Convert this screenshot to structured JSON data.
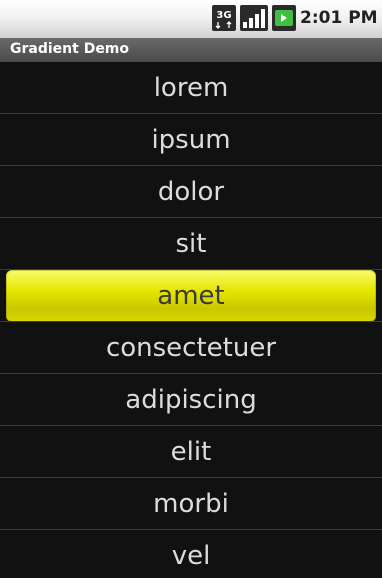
{
  "status_bar": {
    "time": "2:01 PM",
    "network_badge": "3G",
    "icons": [
      "network-3g-icon",
      "signal-strength-icon",
      "battery-icon"
    ]
  },
  "title_bar": {
    "title": "Gradient Demo"
  },
  "list": {
    "selected_index": 4,
    "items": [
      "lorem",
      "ipsum",
      "dolor",
      "sit",
      "amet",
      "consectetuer",
      "adipiscing",
      "elit",
      "morbi",
      "vel"
    ]
  },
  "colors": {
    "list_background": "#111111",
    "list_text": "#dcdcdc",
    "selection_gradient_top": "#fafa6e",
    "selection_gradient_bottom": "#c8c800",
    "title_bar": "#4a4a4a"
  }
}
